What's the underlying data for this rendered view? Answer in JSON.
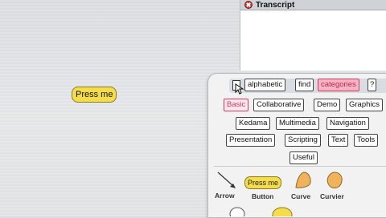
{
  "world": {
    "button_label": "Press me"
  },
  "transcript": {
    "title": "Transcript"
  },
  "catalog": {
    "header_buttons": [
      {
        "label": "alphabetic"
      },
      {
        "label": "find"
      },
      {
        "label": "categories"
      },
      {
        "label": "?"
      }
    ],
    "categories": [
      {
        "label": "Basic"
      },
      {
        "label": "Collaborative"
      },
      {
        "label": "Demo"
      },
      {
        "label": "Graphics"
      },
      {
        "label": "Kedama"
      },
      {
        "label": "Multimedia"
      },
      {
        "label": "Navigation"
      },
      {
        "label": "Presentation"
      },
      {
        "label": "Scripting"
      },
      {
        "label": "Text"
      },
      {
        "label": "Tools"
      },
      {
        "label": "Useful"
      }
    ],
    "objects": [
      {
        "label": "Arrow",
        "icon": "arrow-icon"
      },
      {
        "label": "Button",
        "icon": "button-icon",
        "preview_text": "Press me"
      },
      {
        "label": "Curve",
        "icon": "curve-icon"
      },
      {
        "label": "Curvier",
        "icon": "curvier-icon"
      }
    ],
    "colors": {
      "accent_pink": "#d33a60",
      "button_yellow": "#f4dc4a",
      "shape_orange": "#f0b25a",
      "close_red": "#cc3b3b"
    }
  }
}
